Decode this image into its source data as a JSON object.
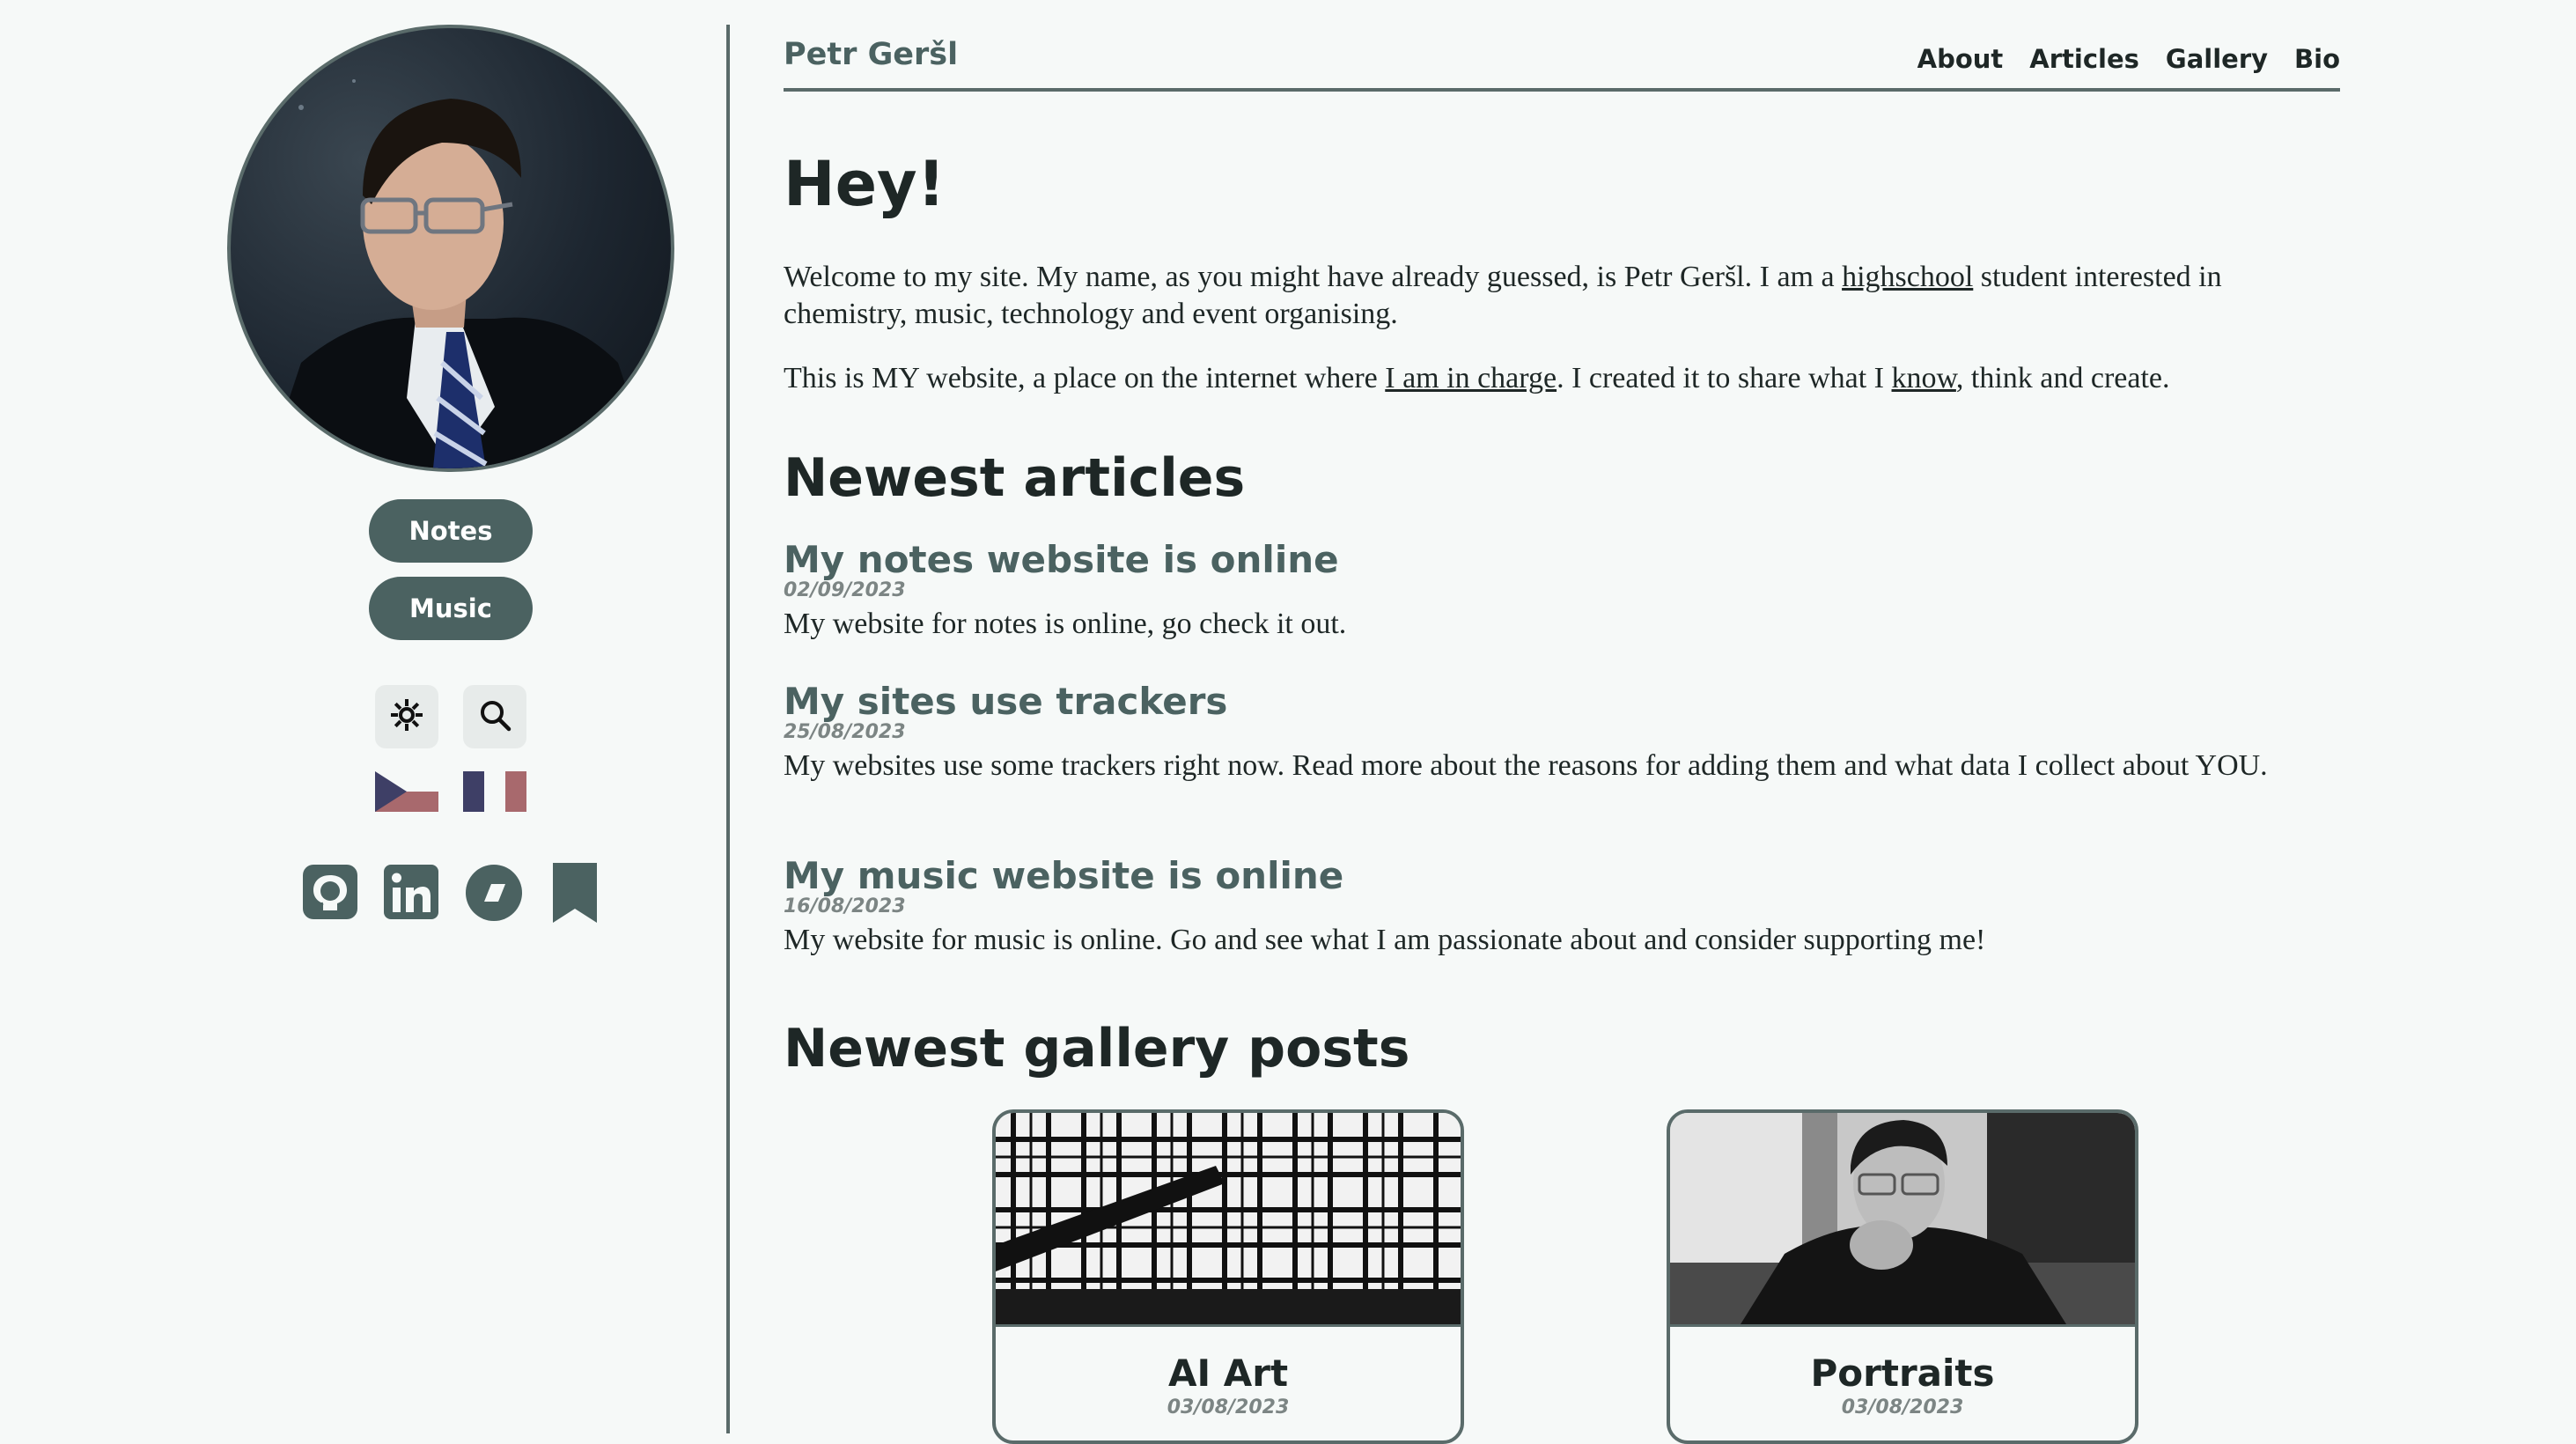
{
  "sidebar": {
    "buttons": {
      "notes": "Notes",
      "music": "Music"
    },
    "icons": {
      "theme": "sun-icon",
      "search": "search-icon"
    },
    "flags": [
      "czech-flag-icon",
      "french-flag-icon"
    ],
    "social": [
      "github-icon",
      "linkedin-icon",
      "blog-icon",
      "bookmark-icon"
    ]
  },
  "header": {
    "site_name": "Petr Geršl",
    "nav": [
      "About",
      "Articles",
      "Gallery",
      "Bio"
    ]
  },
  "intro": {
    "heading": "Hey!",
    "p1_a": "Welcome to my site. My name, as you might have already guessed, is Petr Geršl. I am a ",
    "p1_link": "highschool",
    "p1_b": " student interested in chemistry, music, technology and event organising.",
    "p2_a": "This is MY website, a place on the internet where ",
    "p2_link1": "I am in charge",
    "p2_b": ". I created it to share what I ",
    "p2_link2": "know",
    "p2_c": ", think and create."
  },
  "articles": {
    "heading": "Newest articles",
    "items": [
      {
        "title": "My notes website is online",
        "date": "02/09/2023",
        "desc": "My website for notes is online, go check it out."
      },
      {
        "title": "My sites use trackers",
        "date": "25/08/2023",
        "desc": "My websites use some trackers right now. Read more about the reasons for adding them and what data I collect about YOU."
      },
      {
        "title": "My music website is online",
        "date": "16/08/2023",
        "desc": "My website for music is online. Go and see what I am passionate about and consider supporting me!"
      }
    ]
  },
  "gallery": {
    "heading": "Newest gallery posts",
    "items": [
      {
        "title": "AI Art",
        "date": "03/08/2023"
      },
      {
        "title": "Portraits",
        "date": "03/08/2023"
      }
    ]
  },
  "colors": {
    "accent": "#4b6261",
    "background": "#f6f9f8",
    "text": "#1e2726"
  }
}
